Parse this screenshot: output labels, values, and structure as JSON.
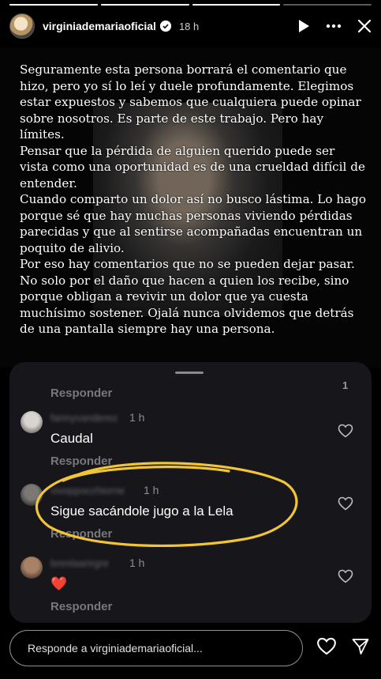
{
  "header": {
    "username": "virginiademariaoficial",
    "time": "18 h"
  },
  "story": {
    "paragraphs": [
      "Seguramente esta persona borrará el comentario que hizo, pero yo sí lo leí y duele profundamente. Elegimos estar expuestos y sabemos que cualquiera puede opinar sobre nosotros. Es parte de este trabajo. Pero hay límites.",
      "Pensar que la pérdida de alguien querido puede ser vista como una oportunidad es de una crueldad difícil de entender.",
      "Cuando comparto un dolor así no busco lástima. Lo hago porque sé que hay muchas personas viviendo pérdidas parecidas y que al sentirse acompañadas encuentran un poquito de alivio.",
      "Por eso hay comentarios que no se pueden dejar pasar. No solo por el daño que hacen a quien los recibe, sino porque obligan a revivir un dolor que ya cuesta muchísimo sostener. Ojalá nunca olvidemos que detrás de una pantalla siempre hay una persona."
    ]
  },
  "sheet": {
    "reply_label_top": "Responder",
    "count": "1",
    "comments": [
      {
        "username": "fannyvanderez",
        "time": "1 h",
        "text": "Caudal",
        "reply": "Responder"
      },
      {
        "username": "vivoppocchiorne",
        "time": "1 h",
        "text": "Sigue sacándole jugo a la Lela",
        "reply": "Responder"
      },
      {
        "username": "brenlaarirgre",
        "time": "1 h",
        "text": "❤️",
        "reply": "Responder"
      }
    ]
  },
  "footer": {
    "placeholder": "Responde a virginiademariaoficial..."
  },
  "colors": {
    "highlight_circle": "#f2c537",
    "sheet_bg": "#17171b"
  },
  "icons": [
    "verified-badge-icon",
    "play-icon",
    "more-icon",
    "close-icon",
    "sound-icon",
    "heart-icon",
    "send-icon"
  ]
}
